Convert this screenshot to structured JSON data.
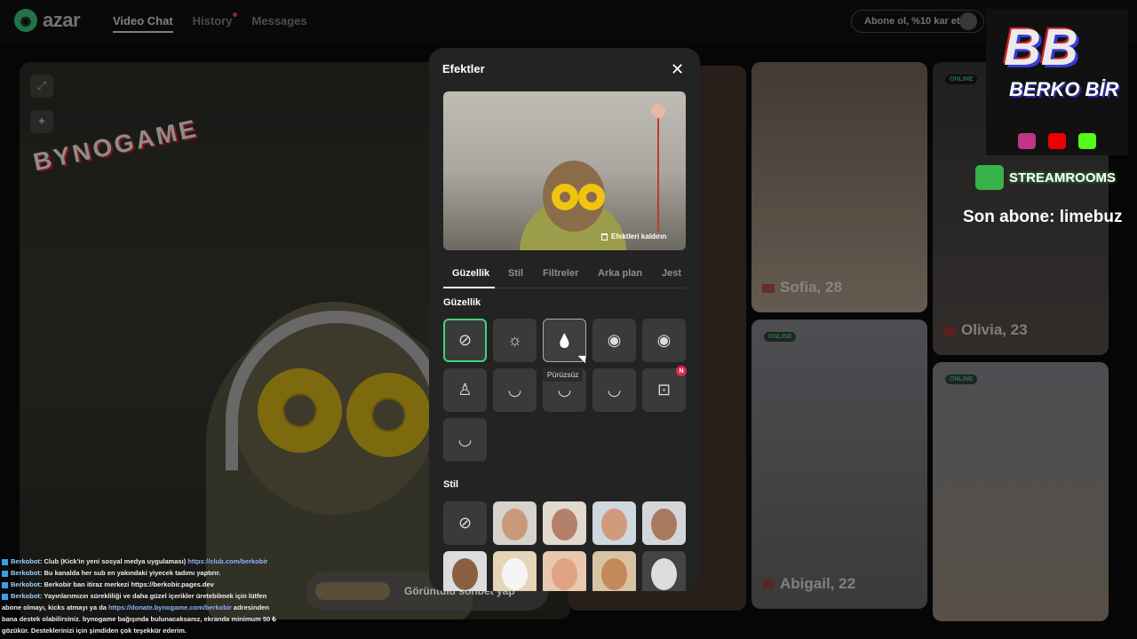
{
  "app": {
    "logo_text": "azar",
    "nav": [
      "Video Chat",
      "History",
      "Messages"
    ],
    "subscribe_label": "Abone ol, %10 kar et"
  },
  "overlay": {
    "bynogame": "BYNOGAME",
    "streamer_logo": "BB",
    "streamer_name": "BERKO BİR",
    "streamrooms": "STREAMROOMS",
    "last_sub": "Son abone: limebuz"
  },
  "cards": [
    {
      "name": "Sofia, 28",
      "online": ""
    },
    {
      "name": "Olivia, 23",
      "online": "ONLINE"
    },
    {
      "name": "Abigail, 22",
      "online": "ONLINE"
    },
    {
      "name": "",
      "online": "ONLINE"
    }
  ],
  "bottom_bar": {
    "label": "Görüntülü sohbet yap"
  },
  "chat": [
    {
      "user": "Berkobot",
      "text": ": Club (Kick'in yeni sosyal medya uygulaması) ",
      "link": "https://club.com/berkobir"
    },
    {
      "user": "Berkobot",
      "text": ": Bu kanalda her sub en yakındaki yiyecek tadımı yaptırır.",
      "link": ""
    },
    {
      "user": "Berkobot",
      "text": ": Berkobir ban itiraz merkezi https://berkobir.pages.dev",
      "link": ""
    },
    {
      "user": "Berkobot",
      "text": ": Yayınlarımızın sürekliliği ve daha güzel içerikler üretebilmek için lütfen abone olmayı, kicks atmayı ya da ",
      "link": "https://donate.bynogame.com/berkobir",
      "text2": " adresinden bana destek olabilirsiniz. bynogame bağışında bulunacaksanız, ekranda minimum 50 ₺ gözükür. Desteklerinizi için şimdiden çok teşekkür ederim."
    }
  ],
  "modal": {
    "title": "Efektler",
    "close_icon": "close-icon",
    "remove_effects": "Efektleri kaldırın",
    "tabs": [
      "Güzellik",
      "Stil",
      "Filtreler",
      "Arka plan",
      "Jest"
    ],
    "active_tab": "Güzellik",
    "section_beauty": "Güzellik",
    "section_style": "Stil",
    "beauty_tiles": [
      {
        "icon": "⊘",
        "name": "none"
      },
      {
        "icon": "☼",
        "name": "brightness"
      },
      {
        "icon": "💧",
        "name": "smooth"
      },
      {
        "icon": "◉",
        "name": "eye"
      },
      {
        "icon": "◉",
        "name": "eye-plus"
      },
      {
        "icon": "♙",
        "name": "nose"
      },
      {
        "icon": "◡",
        "name": "jaw"
      },
      {
        "icon": "◡",
        "name": "chin"
      },
      {
        "icon": "◡",
        "name": "cheek"
      },
      {
        "icon": "⊡",
        "name": "face-frame",
        "badge": "N"
      },
      {
        "icon": "◡",
        "name": "face-slim"
      }
    ],
    "tooltip": "Pürüzsüz",
    "badge_new": "N",
    "style_none": "⊘"
  },
  "colors": {
    "accent": "#3fd27f",
    "badge": "#e0294a",
    "panel": "#232323"
  }
}
